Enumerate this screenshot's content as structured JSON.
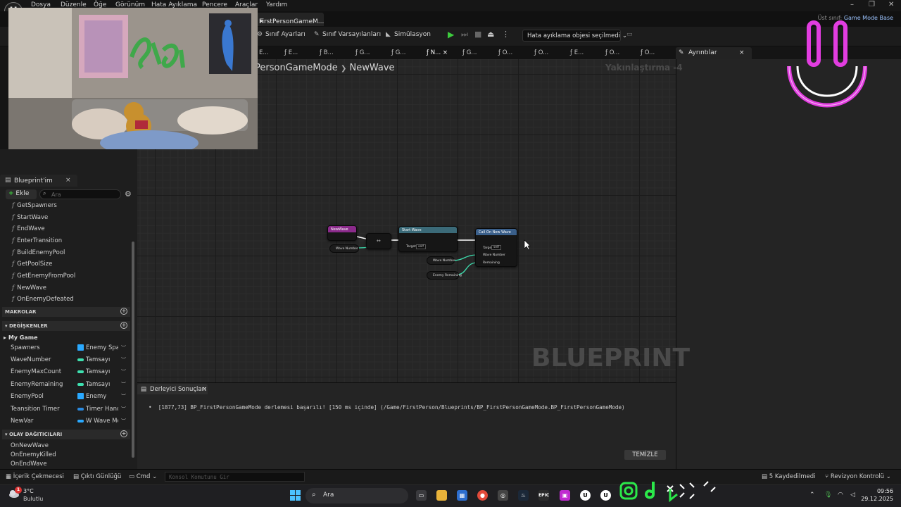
{
  "menu": [
    "Dosya",
    "Düzenle",
    "Öğe",
    "Görünüm",
    "Hata Ayıklama",
    "Pencere",
    "Araçlar",
    "Yardım"
  ],
  "document_tab": {
    "title": "FirstPersonGameM...",
    "dirty_marker": "•",
    "close": "×"
  },
  "parent_class": {
    "label": "Üst sınıf:",
    "value": "Game Mode Base"
  },
  "toolbar": {
    "class_settings": "Sınıf Ayarları",
    "class_defaults": "Sınıf Varsayılanları",
    "simulation": "Simülasyon",
    "debug_object": "Hata ayıklama objesi seçilmedi"
  },
  "function_tabs": [
    "E...",
    "E...",
    "B...",
    "G...",
    "G...",
    "N...",
    "G...",
    "O...",
    "O...",
    "E...",
    "O...",
    "O..."
  ],
  "details_tab": {
    "label": "Ayrıntılar",
    "close": "×"
  },
  "breadcrumb": {
    "parent": "PersonGameMode",
    "separator": "❯",
    "current": "NewWave"
  },
  "zoom_label": "Yakınlaştırma -4",
  "watermark": "BLUEPRINT",
  "nodes": {
    "event": {
      "title": "NewWave",
      "pin": "Wave Number"
    },
    "set": {
      "title": "Start Wave",
      "target_label": "Target",
      "self": "self"
    },
    "call": {
      "title": "Call On New Wave",
      "target_label": "Target",
      "self": "self",
      "pin1": "Wave Number",
      "pin2": "Remaining"
    },
    "var1": "Wave Number",
    "var2": "Enemy Remaining"
  },
  "left_panel": {
    "tab_label": "Blueprint'im",
    "tab_close": "×",
    "add_label": "Ekle",
    "search_placeholder": "Ara",
    "functions": [
      "GetSpawners",
      "StartWave",
      "EndWave",
      "EnterTransition",
      "BuildEnemyPool",
      "GetPoolSize",
      "GetEnemyFromPool",
      "NewWave",
      "OnEnemyDefeated"
    ],
    "macros_header": "MAKROLAR",
    "variables_header": "DEĞİŞKENLER",
    "category": "My Game",
    "variables": [
      {
        "name": "Spawners",
        "type": "Enemy Spaw",
        "color": "#2aa9ff"
      },
      {
        "name": "WaveNumber",
        "type": "Tamsayı",
        "color": "#3ee0b0"
      },
      {
        "name": "EnemyMaxCount",
        "type": "Tamsayı",
        "color": "#3ee0b0"
      },
      {
        "name": "EnemyRemaining",
        "type": "Tamsayı",
        "color": "#3ee0b0"
      },
      {
        "name": "EnemyPool",
        "type": "Enemy",
        "color": "#2aa9ff"
      },
      {
        "name": "Teansition Timer",
        "type": "Timer Hand",
        "color": "#2a8ae0"
      },
      {
        "name": "NewVar",
        "type": "W Wave Mo",
        "color": "#2aa9ff"
      }
    ],
    "dispatchers_header": "OLAY DAĞITICILARI",
    "dispatchers": [
      "OnNewWave",
      "OnEnemyKilled",
      "OnEndWave"
    ]
  },
  "compiler": {
    "tab_label": "Derleyici Sonuçları",
    "tab_close": "×",
    "message": "[1877,73] BP_FirstPersonGameMode derlemesi başarılı! [150 ms içinde] (/Game/FirstPerson/Blueprints/BP_FirstPersonGameMode.BP_FirstPersonGameMode)",
    "clear_label": "TEMİZLE"
  },
  "statusbar": {
    "content_drawer": "İçerik Çekmecesi",
    "output_log": "Çıktı Günlüğü",
    "cmd": "Cmd",
    "console_placeholder": "Konsol Komutunu Gir",
    "unsaved": "5 Kaydedilmedi",
    "revision": "Revizyon Kontrolü"
  },
  "taskbar": {
    "temperature": "3°C",
    "condition": "Bulutlu",
    "weather_badge": "1",
    "search_label": "Ara",
    "time": "09:56",
    "date": "29.12.2025"
  },
  "colors": {
    "accent_green": "#3dcc3d",
    "link_blue": "#9cc4ff",
    "overlay_pink": "#e23de0"
  }
}
